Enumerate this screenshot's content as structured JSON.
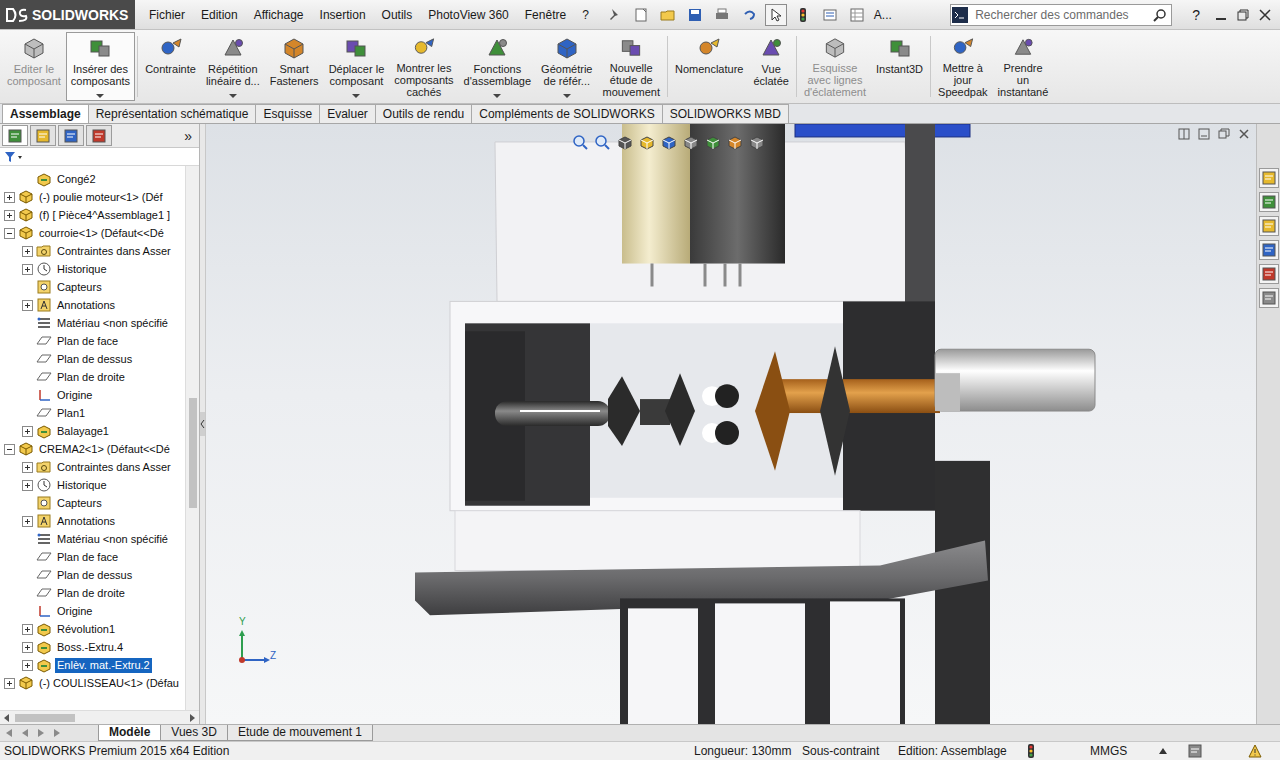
{
  "app": {
    "logo": "SOLIDWORKS",
    "menu": [
      {
        "label": "Fichier"
      },
      {
        "label": "Edition"
      },
      {
        "label": "Affichage"
      },
      {
        "label": "Insertion"
      },
      {
        "label": "Outils"
      },
      {
        "label": "PhotoView 360"
      },
      {
        "label": "Fenêtre"
      },
      {
        "label": "?"
      }
    ],
    "menu_more": "A...",
    "search": {
      "placeholder": "Rechercher des commandes"
    },
    "help": "?"
  },
  "ribbon": [
    {
      "label": "Editer le\ncomposant",
      "disabled": true,
      "active": false,
      "dropdown": false
    },
    {
      "label": "Insérer des\ncomposants",
      "disabled": false,
      "active": true,
      "dropdown": true
    },
    {
      "label": "Contrainte",
      "disabled": false,
      "active": false,
      "dropdown": false
    },
    {
      "label": "Répétition\nlinéaire d...",
      "disabled": false,
      "active": false,
      "dropdown": true
    },
    {
      "label": "Smart\nFasteners",
      "disabled": false,
      "active": false,
      "dropdown": false
    },
    {
      "label": "Déplacer le\ncomposant",
      "disabled": false,
      "active": false,
      "dropdown": true
    },
    {
      "label": "Montrer les\ncomposants\ncachés",
      "disabled": false,
      "active": false,
      "dropdown": false
    },
    {
      "label": "Fonctions\nd'assemblage",
      "disabled": false,
      "active": false,
      "dropdown": true
    },
    {
      "label": "Géométrie\nde référ...",
      "disabled": false,
      "active": false,
      "dropdown": true
    },
    {
      "label": "Nouvelle\nétude de\nmouvement",
      "disabled": false,
      "active": false,
      "dropdown": false
    },
    {
      "label": "Nomenclature",
      "disabled": false,
      "active": false,
      "dropdown": false
    },
    {
      "label": "Vue\néclatée",
      "disabled": false,
      "active": false,
      "dropdown": false
    },
    {
      "label": "Esquisse\navec lignes\nd'éclatement",
      "disabled": true,
      "active": false,
      "dropdown": false
    },
    {
      "label": "Instant3D",
      "disabled": false,
      "active": false,
      "dropdown": false
    },
    {
      "label": "Mettre à\njour\nSpeedpak",
      "disabled": false,
      "active": false,
      "dropdown": false
    },
    {
      "label": "Prendre\nun\ninstantané",
      "disabled": false,
      "active": false,
      "dropdown": false
    }
  ],
  "tabs": [
    {
      "label": "Assemblage",
      "selected": true
    },
    {
      "label": "Représentation schématique",
      "selected": false
    },
    {
      "label": "Esquisse",
      "selected": false
    },
    {
      "label": "Evaluer",
      "selected": false
    },
    {
      "label": "Outils de rendu",
      "selected": false
    },
    {
      "label": "Compléments de SOLIDWORKS",
      "selected": false
    },
    {
      "label": "SOLIDWORKS MBD",
      "selected": false
    }
  ],
  "tree": {
    "panel_tabs": [
      {
        "selected": true
      },
      {
        "selected": false
      },
      {
        "selected": false
      },
      {
        "selected": false
      }
    ],
    "more": "»",
    "items": [
      {
        "label": "Congé2",
        "depth": 1,
        "kind": "feature",
        "expandable": false,
        "expanded": false,
        "selected": false
      },
      {
        "label": "(-) poulie moteur<1> (Déf",
        "depth": 0,
        "kind": "component",
        "expandable": true,
        "expanded": false,
        "selected": false
      },
      {
        "label": "(f) [ Pièce4^Assemblage1 ]",
        "depth": 0,
        "kind": "component",
        "expandable": true,
        "expanded": false,
        "selected": false
      },
      {
        "label": "courroie<1> (Défaut<<Dé",
        "depth": 0,
        "kind": "component",
        "expandable": true,
        "expanded": true,
        "selected": false
      },
      {
        "label": "Contraintes dans Asser",
        "depth": 1,
        "kind": "folder",
        "expandable": true,
        "expanded": false,
        "selected": false
      },
      {
        "label": "Historique",
        "depth": 1,
        "kind": "history",
        "expandable": true,
        "expanded": false,
        "selected": false
      },
      {
        "label": "Capteurs",
        "depth": 1,
        "kind": "sensor",
        "expandable": false,
        "expanded": false,
        "selected": false
      },
      {
        "label": "Annotations",
        "depth": 1,
        "kind": "annotation",
        "expandable": true,
        "expanded": false,
        "selected": false
      },
      {
        "label": "Matériau <non spécifié",
        "depth": 1,
        "kind": "material",
        "expandable": false,
        "expanded": false,
        "selected": false
      },
      {
        "label": "Plan de face",
        "depth": 1,
        "kind": "plane",
        "expandable": false,
        "expanded": false,
        "selected": false
      },
      {
        "label": "Plan de dessus",
        "depth": 1,
        "kind": "plane",
        "expandable": false,
        "expanded": false,
        "selected": false
      },
      {
        "label": "Plan de droite",
        "depth": 1,
        "kind": "plane",
        "expandable": false,
        "expanded": false,
        "selected": false
      },
      {
        "label": "Origine",
        "depth": 1,
        "kind": "origin",
        "expandable": false,
        "expanded": false,
        "selected": false
      },
      {
        "label": "Plan1",
        "depth": 1,
        "kind": "plane",
        "expandable": false,
        "expanded": false,
        "selected": false
      },
      {
        "label": "Balayage1",
        "depth": 1,
        "kind": "feature",
        "expandable": true,
        "expanded": false,
        "selected": false
      },
      {
        "label": "CREMA2<1> (Défaut<<Dé",
        "depth": 0,
        "kind": "component",
        "expandable": true,
        "expanded": true,
        "selected": false
      },
      {
        "label": "Contraintes dans Asser",
        "depth": 1,
        "kind": "folder",
        "expandable": true,
        "expanded": false,
        "selected": false
      },
      {
        "label": "Historique",
        "depth": 1,
        "kind": "history",
        "expandable": true,
        "expanded": false,
        "selected": false
      },
      {
        "label": "Capteurs",
        "depth": 1,
        "kind": "sensor",
        "expandable": false,
        "expanded": false,
        "selected": false
      },
      {
        "label": "Annotations",
        "depth": 1,
        "kind": "annotation",
        "expandable": true,
        "expanded": false,
        "selected": false
      },
      {
        "label": "Matériau <non spécifié",
        "depth": 1,
        "kind": "material",
        "expandable": false,
        "expanded": false,
        "selected": false
      },
      {
        "label": "Plan de face",
        "depth": 1,
        "kind": "plane",
        "expandable": false,
        "expanded": false,
        "selected": false
      },
      {
        "label": "Plan de dessus",
        "depth": 1,
        "kind": "plane",
        "expandable": false,
        "expanded": false,
        "selected": false
      },
      {
        "label": "Plan de droite",
        "depth": 1,
        "kind": "plane",
        "expandable": false,
        "expanded": false,
        "selected": false
      },
      {
        "label": "Origine",
        "depth": 1,
        "kind": "origin",
        "expandable": false,
        "expanded": false,
        "selected": false
      },
      {
        "label": "Révolution1",
        "depth": 1,
        "kind": "feature",
        "expandable": true,
        "expanded": false,
        "selected": false
      },
      {
        "label": "Boss.-Extru.4",
        "depth": 1,
        "kind": "feature",
        "expandable": true,
        "expanded": false,
        "selected": false
      },
      {
        "label": "Enlèv. mat.-Extru.2",
        "depth": 1,
        "kind": "feature",
        "expandable": true,
        "expanded": false,
        "selected": true
      },
      {
        "label": "(-) COULISSEAU<1> (Défau",
        "depth": 0,
        "kind": "component",
        "expandable": true,
        "expanded": false,
        "selected": false
      }
    ]
  },
  "triad": {
    "y": "Y",
    "z": "Z"
  },
  "bottom_tabs": [
    {
      "label": "Modèle",
      "selected": true
    },
    {
      "label": "Vues 3D",
      "selected": false
    },
    {
      "label": "Etude de mouvement 1",
      "selected": false
    }
  ],
  "status_bar": {
    "edition": "SOLIDWORKS Premium 2015 x64 Edition",
    "length": "Longueur: 130mm",
    "state": "Sous-contraint",
    "mode": "Edition: Assemblage",
    "units": "MMGS"
  }
}
